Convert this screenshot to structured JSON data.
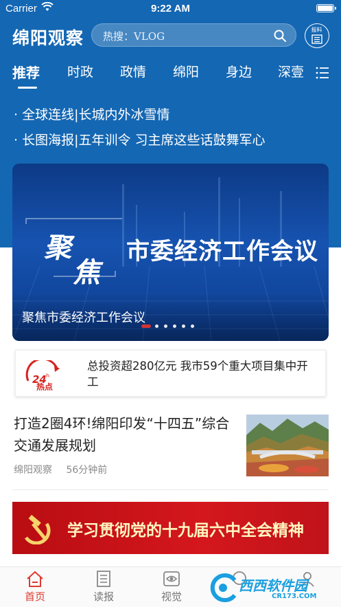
{
  "status_bar": {
    "carrier": "Carrier",
    "time": "9:22 AM"
  },
  "header": {
    "logo": "绵阳观察",
    "search_text": "热搜：VLOG",
    "paper_button_label": "报料"
  },
  "tabs": [
    {
      "label": "推荐",
      "active": true
    },
    {
      "label": "时政"
    },
    {
      "label": "政情"
    },
    {
      "label": "绵阳"
    },
    {
      "label": "身边"
    },
    {
      "label": "深壹"
    }
  ],
  "headlines": [
    "· 全球连线|长城内外冰雪情",
    "· 长图海报|五年训令  习主席这些话鼓舞军心"
  ],
  "banner": {
    "title_ju": "聚",
    "title_jiao": "焦",
    "title_main": "市委经济工作会议",
    "caption": "聚焦市委经济工作会议",
    "slide_count": 6,
    "active_slide": 1
  },
  "hot_card": {
    "logo_text": "24h热点",
    "text": "总投资超280亿元  我市59个重大项目集中开工"
  },
  "news": [
    {
      "title": "打造2圈4环!绵阳印发“十四五”综合交通发展规划",
      "source": "绵阳观察",
      "time": "56分钟前"
    }
  ],
  "party_banner": {
    "text": "学习贯彻党的十九届六中全会精神"
  },
  "bottom_nav": [
    {
      "label": "首页",
      "icon": "home-icon",
      "active": true
    },
    {
      "label": "读报",
      "icon": "newspaper-icon"
    },
    {
      "label": "视觉",
      "icon": "eye-icon"
    },
    {
      "label": "",
      "icon": "activity-icon"
    },
    {
      "label": "",
      "icon": "user-icon"
    }
  ],
  "watermark": {
    "brand": "西西软件园",
    "url": "CR173.COM"
  },
  "colors": {
    "brand_blue": "#1467b3",
    "accent_red": "#e03a2f",
    "party_red": "#c8151b"
  }
}
